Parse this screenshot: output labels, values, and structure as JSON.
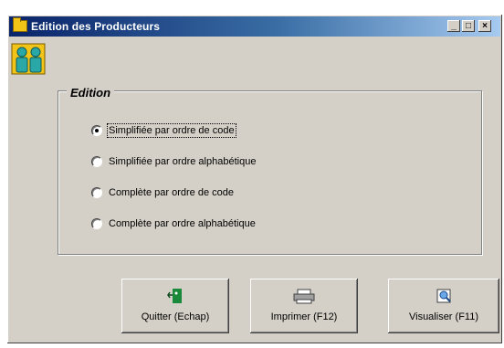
{
  "window": {
    "title": "Edition des Producteurs",
    "controls": {
      "minimize": "_",
      "maximize": "□",
      "close": "×"
    }
  },
  "app_icon": "two-people-icon",
  "edition": {
    "legend": "Edition",
    "options": [
      {
        "label": "Simplifiée par ordre de code",
        "selected": true
      },
      {
        "label": "Simplifiée par ordre alphabétique",
        "selected": false
      },
      {
        "label": "Complète par ordre de code",
        "selected": false
      },
      {
        "label": "Complète par ordre alphabétique",
        "selected": false
      }
    ]
  },
  "buttons": {
    "quit": {
      "label": "Quitter (Echap)",
      "icon": "exit-door-icon"
    },
    "print": {
      "label": "Imprimer (F12)",
      "icon": "printer-icon"
    },
    "preview": {
      "label": "Visualiser (F11)",
      "icon": "preview-icon"
    }
  },
  "colors": {
    "titlebar_start": "#0a246a",
    "titlebar_end": "#a6caf0",
    "face": "#d4d0c8"
  }
}
